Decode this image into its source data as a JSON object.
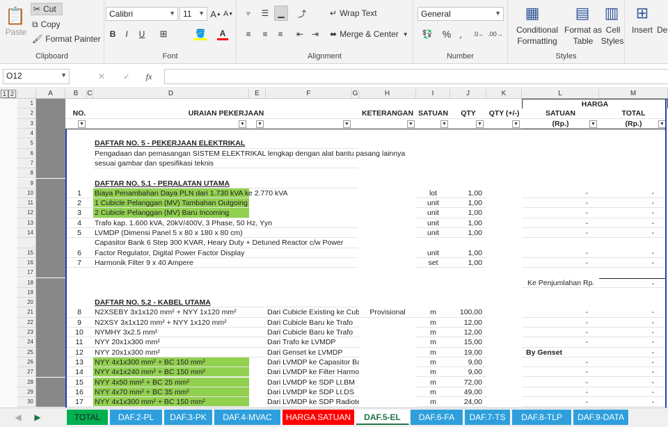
{
  "ribbon": {
    "clipboard": {
      "paste": "Paste",
      "cut": "Cut",
      "copy": "Copy",
      "format_painter": "Format Painter",
      "label": "Clipboard"
    },
    "font": {
      "name": "Calibri",
      "size": "11",
      "label": "Font",
      "bold": "B",
      "italic": "I",
      "underline": "U"
    },
    "alignment": {
      "wrap": "Wrap Text",
      "merge": "Merge & Center",
      "label": "Alignment"
    },
    "number": {
      "format": "General",
      "label": "Number"
    },
    "styles": {
      "conditional": "Conditional",
      "conditional2": "Formatting",
      "format_as": "Format as",
      "format_as2": "Table",
      "cell": "Cell",
      "cell2": "Styles",
      "label": "Styles"
    },
    "cells": {
      "insert": "Insert",
      "delete": "De"
    }
  },
  "formula_bar": {
    "name_box": "O12",
    "fx": "fx",
    "cancel": "✕",
    "enter": "✓",
    "value": ""
  },
  "outline": {
    "l1": "1",
    "l2": "2"
  },
  "columns": [
    "A",
    "B",
    "C",
    "D",
    "E",
    "F",
    "G",
    "H",
    "I",
    "J",
    "K",
    "L",
    "M"
  ],
  "header": {
    "harga": "HARGA",
    "no": "NO.",
    "uraian": "URAIAN PEKERJAAN",
    "keterangan": "KETERANGAN",
    "satuan": "SATUAN",
    "qty": "QTY",
    "qty_pm": "QTY (+/-)",
    "l_satuan": "SATUAN",
    "l_rp": "(Rp.)",
    "m_total": "TOTAL",
    "m_rp": "(Rp.)"
  },
  "rows": [
    {
      "n": "4"
    },
    {
      "n": "5",
      "d": "DAFTAR NO. 5 - PEKERJAAN ELEKTRIKAL",
      "bu": true
    },
    {
      "n": "6",
      "d": "Pengadaan dan pemasangan SISTEM ELEKTRIKAL lengkap dengan alat bantu pasang lainnya"
    },
    {
      "n": "7",
      "d": "sesuai gambar dan spesifikasi teknis"
    },
    {
      "n": "8"
    },
    {
      "n": "9",
      "d": "DAFTAR NO. 5.1 - PERALATAN UTAMA",
      "bu": true
    },
    {
      "n": "10",
      "b": "1",
      "d": "Biaya Penambahan Daya PLN dari 1.730 kVA ke 2.770 kVA",
      "g": true,
      "i": "lot",
      "j": "1,00",
      "l": "-",
      "m": "-"
    },
    {
      "n": "11",
      "b": "2",
      "d": "1 Cubicle Pelanggan (MV) Tambahan Outgoing",
      "g": true,
      "i": "unit",
      "j": "1,00",
      "l": "-",
      "m": "-"
    },
    {
      "n": "12",
      "b": "3",
      "d": "2 Cubicle Pelanggan (MV) Baru Incoming",
      "g": true,
      "i": "unit",
      "j": "1,00",
      "l": "-",
      "m": "-"
    },
    {
      "n": "13",
      "b": "4",
      "d": "Trafo kap. 1.600 kVA, 20kV/400V, 3 Phase, 50 Hz, Yyn",
      "i": "unit",
      "j": "1,00",
      "l": "-",
      "m": "-"
    },
    {
      "n": "14",
      "b": "5",
      "d": "LVMDP (Dimensi Panel 5 x 80 x 180 x 80 cm)",
      "i": "unit",
      "j": "1,00",
      "l": "-",
      "m": "-"
    },
    {
      "n": "",
      "d": "Capasitor Bank 6 Step 300 KVAR, Heary Duty + Detuned Reactor c/w Power"
    },
    {
      "n": "15",
      "b": "6",
      "d": "Factor Regulator, Digital Power Factor Display",
      "i": "unit",
      "j": "1,00",
      "l": "-",
      "m": "-"
    },
    {
      "n": "16",
      "b": "7",
      "d": "Harmonik Filter 9 x 40 Ampere",
      "i": "set",
      "j": "1,00",
      "l": "-",
      "m": "-"
    },
    {
      "n": "17"
    },
    {
      "n": "18",
      "lk": "Ke Penjumlahan",
      "lrp": "Rp.",
      "m": "-"
    },
    {
      "n": "19"
    },
    {
      "n": "20",
      "d": "DAFTAR NO. 5.2 - KABEL UTAMA",
      "bu": true
    },
    {
      "n": "21",
      "b": "8",
      "d": "N2XSEBY 3x1x120 mm² + NYY 1x120 mm²",
      "f": "Dari Cubicle Existing ke Cubi",
      "h": "Provisional",
      "i": "m",
      "j": "100,00",
      "l": "-",
      "m": "-"
    },
    {
      "n": "22",
      "b": "9",
      "d": "N2XSY 3x1x120 mm² + NYY 1x120 mm²",
      "f": "Dari Cubicle Baru ke Trafo",
      "i": "m",
      "j": "12,00",
      "l": "-",
      "m": "-"
    },
    {
      "n": "23",
      "b": "10",
      "d": "NYMHY 3x2.5 mm²",
      "f": "Dari Cubicle Baru ke Trafo",
      "i": "m",
      "j": "12,00",
      "l": "-",
      "m": "-"
    },
    {
      "n": "24",
      "b": "11",
      "d": "NYY 20x1x300 mm²",
      "f": "Dari Trafo ke LVMDP",
      "i": "m",
      "j": "15,00",
      "l": "-",
      "m": "-"
    },
    {
      "n": "25",
      "b": "12",
      "d": "NYY 20x1x300 mm²",
      "f": "Dari Genset ke LVMDP",
      "i": "m",
      "j": "19,00",
      "lb": "By Genset",
      "m": "-"
    },
    {
      "n": "26",
      "b": "13",
      "d": "NYY 4x1x300 mm² + BC 150 mm²",
      "g": true,
      "f": "Dari LVMDP ke Capasitor Bank",
      "i": "m",
      "j": "9,00",
      "l": "-",
      "m": "-"
    },
    {
      "n": "27",
      "b": "14",
      "d": "NYY 4x1x240 mm² + BC 150 mm²",
      "g": true,
      "f": "Dari LVMDP ke Filter Harmonik",
      "i": "m",
      "j": "9,00",
      "l": "-",
      "m": "-"
    },
    {
      "n": "28",
      "b": "15",
      "d": "NYY 4x50 mm² + BC 25 mm²",
      "g": true,
      "f": "Dari LVMDP ke SDP Lt.BM",
      "i": "m",
      "j": "72,00",
      "l": "-",
      "m": "-"
    },
    {
      "n": "29",
      "b": "16",
      "d": "NYY 4x70 mm² + BC 35 mm²",
      "g": true,
      "f": "Dari LVMDP ke SDP Lt.DS",
      "i": "m",
      "j": "49,00",
      "l": "-",
      "m": "-"
    },
    {
      "n": "30",
      "b": "17",
      "d": "NYY 4x1x300 mm² + BC 150 mm²",
      "g": true,
      "f": "Dari LVMDP ke SDP Radioterapi",
      "i": "m",
      "j": "24,00",
      "l": "-",
      "m": "-"
    }
  ],
  "tabs": [
    {
      "label": "TOTAL",
      "kind": "total"
    },
    {
      "label": "DAF.2-PL"
    },
    {
      "label": "DAF.3-PK"
    },
    {
      "label": "DAF.4-MVAC"
    },
    {
      "label": "HARGA SATUAN",
      "kind": "red"
    },
    {
      "label": "DAF.5-EL",
      "kind": "active"
    },
    {
      "label": "DAF.6-FA"
    },
    {
      "label": "DAF.7-TS"
    },
    {
      "label": "DAF.8-TLP"
    },
    {
      "label": "DAF.9-DATA"
    }
  ]
}
